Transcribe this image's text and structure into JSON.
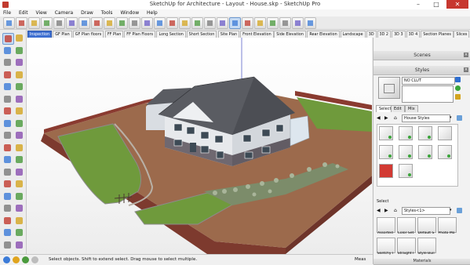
{
  "window": {
    "title": "SketchUp for Architecture - Layout - House.skp - SketchUp Pro",
    "minimize_glyph": "–",
    "maximize_glyph": "□",
    "close_glyph": "✕"
  },
  "menu": [
    "File",
    "Edit",
    "View",
    "Camera",
    "Draw",
    "Tools",
    "Window",
    "Help"
  ],
  "toolbar_icons": [
    "select-icon",
    "eraser-icon",
    "paint-icon",
    "orbit-icon",
    "pan-icon",
    "zoom-icon",
    "zoom-extents-icon",
    "previous-view-icon",
    "next-view-icon",
    "iso-view-icon",
    "top-view-icon",
    "front-view-icon",
    "right-view-icon",
    "back-view-icon",
    "left-view-icon",
    "xray-icon",
    "back-edges-icon",
    "wireframe-icon",
    "hidden-line-icon",
    "shaded-icon",
    "shaded-textures-icon",
    "monochrome-icon",
    "section-plane-icon",
    "section-cuts-icon",
    "section-fill-icon"
  ],
  "scene_tabs": [
    "Inspection",
    "GF Plan",
    "GF Plan floors",
    "FF Plan",
    "FF Plan Floors",
    "Long Section",
    "Short Section",
    "Site Plan",
    "Front Elevation",
    "Side Elevation",
    "Rear Elevation",
    "Landscape",
    "3D",
    "3D 2",
    "3D 3",
    "3D 4",
    "Section Planes",
    "Slices"
  ],
  "active_tab_index": 0,
  "palette_tools": [
    "select-tool-icon",
    "component-icon",
    "paint-bucket-icon",
    "eraser-icon",
    "line-icon",
    "freehand-icon",
    "arc-icon",
    "arc-2-icon",
    "rectangle-icon",
    "rotated-rectangle-icon",
    "circle-icon",
    "polygon-icon",
    "pie-icon",
    "3point-arc-icon",
    "push-pull-icon",
    "offset-icon",
    "move-icon",
    "follow-me-icon",
    "rotate-icon",
    "scale-icon",
    "tape-measure-icon",
    "dimension-icon",
    "protractor-icon",
    "text-icon",
    "axes-icon",
    "3d-text-icon",
    "orbit-icon",
    "pan-icon",
    "zoom-icon",
    "zoom-window-icon",
    "zoom-extents-icon",
    "previous-icon",
    "position-camera-icon",
    "walk-icon",
    "look-around-icon",
    "section-plane-icon"
  ],
  "tray": {
    "scenes_title": "Scenes",
    "styles_title": "Styles",
    "style_name": "NO CLUT",
    "tabs": [
      "Select",
      "Edit",
      "Mix"
    ],
    "library_name": "House Styles",
    "select_label": "Select",
    "model_styles": "Styles<1>",
    "materials": [
      "Assorted",
      "Color Set",
      "Default S",
      "Photo Mo",
      "Sketchy I",
      "Straight I",
      "Style Buil"
    ],
    "materials_title": "Materials"
  },
  "status": {
    "message": "Select objects. Shift to extend select. Drag mouse to select multiple.",
    "measurements_label": "Meas"
  },
  "colors": {
    "active_tab": "#3d6fd1",
    "lawn": "#6f9a3c",
    "paving": "#9c6a4c",
    "brick_wall": "#8a3b30",
    "roof": "#5a5c62",
    "render_wall": "#e7e9ec",
    "close_button": "#c7372f"
  }
}
